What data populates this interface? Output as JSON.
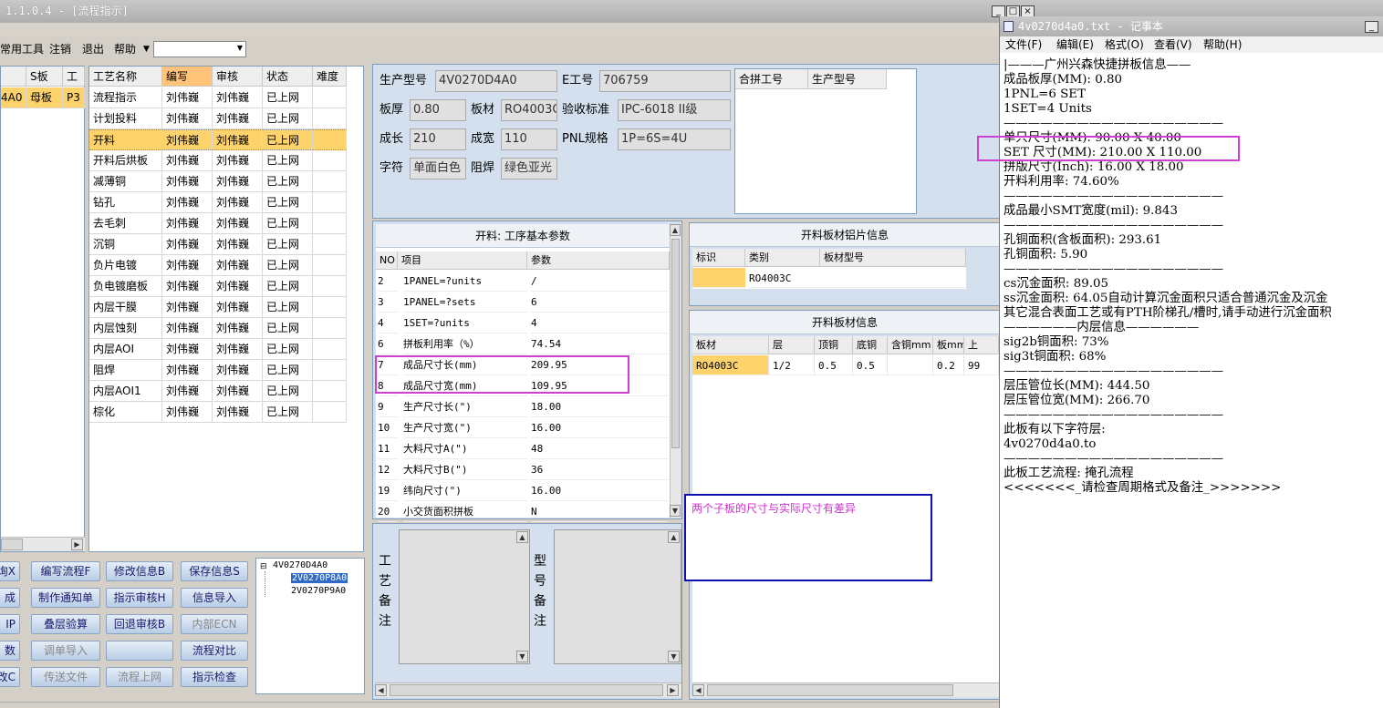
{
  "main_window": {
    "title": "1.1.0.4 - [流程指示]",
    "menu": [
      "常用工具",
      "注销",
      "退出",
      "帮助"
    ],
    "left_grid": {
      "headers": [
        "",
        "S板",
        "工"
      ],
      "row": [
        "4A0",
        "母板",
        "P3"
      ]
    },
    "process_table": {
      "headers": [
        "工艺名称",
        "编写",
        "审核",
        "状态",
        "难度"
      ],
      "rows": [
        [
          "流程指示",
          "刘伟巍",
          "刘伟巍",
          "已上网"
        ],
        [
          "计划投料",
          "刘伟巍",
          "刘伟巍",
          "已上网"
        ],
        [
          "开料",
          "刘伟巍",
          "刘伟巍",
          "已上网"
        ],
        [
          "开料后烘板",
          "刘伟巍",
          "刘伟巍",
          "已上网"
        ],
        [
          "减薄铜",
          "刘伟巍",
          "刘伟巍",
          "已上网"
        ],
        [
          "钻孔",
          "刘伟巍",
          "刘伟巍",
          "已上网"
        ],
        [
          "去毛刺",
          "刘伟巍",
          "刘伟巍",
          "已上网"
        ],
        [
          "沉铜",
          "刘伟巍",
          "刘伟巍",
          "已上网"
        ],
        [
          "负片电镀",
          "刘伟巍",
          "刘伟巍",
          "已上网"
        ],
        [
          "负电镀磨板",
          "刘伟巍",
          "刘伟巍",
          "已上网"
        ],
        [
          "内层干膜",
          "刘伟巍",
          "刘伟巍",
          "已上网"
        ],
        [
          "内层蚀刻",
          "刘伟巍",
          "刘伟巍",
          "已上网"
        ],
        [
          "内层AOI",
          "刘伟巍",
          "刘伟巍",
          "已上网"
        ],
        [
          "阻焊",
          "刘伟巍",
          "刘伟巍",
          "已上网"
        ],
        [
          "内层AOI1",
          "刘伟巍",
          "刘伟巍",
          "已上网"
        ],
        [
          "棕化",
          "刘伟巍",
          "刘伟巍",
          "已上网"
        ]
      ],
      "selected_row": 2
    },
    "info": {
      "model_label": "生产型号",
      "model": "4V0270D4A0",
      "eno_label": "E工号",
      "eno": "706759",
      "thick_label": "板厚",
      "thick": "0.80",
      "material_label": "板材",
      "material": "RO4003C",
      "standard_label": "验收标准",
      "standard": "IPC-6018 II级",
      "length_label": "成长",
      "length": "210",
      "width_label": "成宽",
      "width": "110",
      "pnl_label": "PNL规格",
      "pnl": "1P=6S=4U",
      "char_label": "字符",
      "char": "单面白色",
      "mask_label": "阻焊",
      "mask": "绿色亚光",
      "combo_headers": [
        "合拼工号",
        "生产型号"
      ]
    },
    "params": {
      "title": "开料: 工序基本参数",
      "headers": [
        "NO",
        "项目",
        "参数"
      ],
      "rows": [
        [
          "2",
          "1PANEL=?units",
          "/"
        ],
        [
          "3",
          "1PANEL=?sets",
          "6"
        ],
        [
          "4",
          "1SET=?units",
          "4"
        ],
        [
          "6",
          "拼板利用率（%）",
          "74.54"
        ],
        [
          "7",
          "成品尺寸长(mm)",
          "209.95"
        ],
        [
          "8",
          "成品尺寸宽(mm)",
          "109.95"
        ],
        [
          "9",
          "生产尺寸长(\")",
          "18.00"
        ],
        [
          "10",
          "生产尺寸宽(\")",
          "16.00"
        ],
        [
          "11",
          "大料尺寸A(\")",
          "48"
        ],
        [
          "12",
          "大料尺寸B(\")",
          "36"
        ],
        [
          "19",
          "纬向尺寸(\")",
          "16.00"
        ],
        [
          "20",
          "小交货面积拼板",
          "N"
        ]
      ]
    },
    "foil": {
      "title": "开料板材铝片信息",
      "headers": [
        "标识",
        "类别",
        "板材型号"
      ],
      "row": [
        "",
        "RO4003C",
        ""
      ]
    },
    "board": {
      "title": "开料板材信息",
      "headers": [
        "板材",
        "层",
        "顶铜",
        "底铜",
        "含铜mm",
        "板mm",
        "上"
      ],
      "row": [
        "RO4003C",
        "1/2",
        "0.5",
        "0.5",
        "",
        "0.2",
        "99"
      ]
    },
    "remark_labels": {
      "craft": [
        "工",
        "艺",
        "备",
        "注"
      ],
      "model": [
        "型",
        "号",
        "备",
        "注"
      ]
    },
    "note_text": "两个子板的尺寸与实际尺寸有差异",
    "buttons": {
      "col0": [
        "询X",
        "成",
        "IP",
        "数",
        "改C"
      ],
      "col1": [
        "编写流程F",
        "制作通知单",
        "叠层验算",
        "调单导入",
        "传送文件"
      ],
      "col2": [
        "修改信息B",
        "指示审核H",
        "回退审核B",
        "",
        "流程上网"
      ],
      "col3": [
        "保存信息S",
        "信息导入",
        "内部ECN",
        "流程对比",
        "指示检查"
      ]
    },
    "tree": {
      "root": "4V0270D4A0",
      "children": [
        "2V0270P8A0",
        "2V0270P9A0"
      ]
    }
  },
  "notepad": {
    "title": "4v0270d4a0.txt - 记事本",
    "menu": [
      "文件(F)",
      "编辑(E)",
      "格式(O)",
      "查看(V)",
      "帮助(H)"
    ],
    "lines": [
      "|———广州兴森快捷拼板信息——",
      "成品板厚(MM): 0.80",
      "1PNL=6 SET",
      "1SET=4 Units",
      "——————————————————",
      "单只尺寸(MM): 90.00 X 40.00",
      "SET 尺寸(MM): 210.00 X 110.00",
      "拼版尺寸(Inch): 16.00 X 18.00",
      "开料利用率: 74.60%",
      "——————————————————",
      "成品最小SMT宽度(mil): 9.843",
      "——————————————————",
      "孔铜面积(含板面积): 293.61",
      "孔铜面积: 5.90",
      "——————————————————",
      "cs沉金面积: 89.05",
      "ss沉金面积: 64.05自动计算沉金面积只适合普通沉金及沉金",
      "其它混合表面工艺或有PTH阶梯孔/槽时,请手动进行沉金面积",
      "——————内层信息——————",
      "sig2b铜面积: 73%",
      "sig3t铜面积: 68%",
      "——————————————————",
      "层压管位长(MM): 444.50",
      "层压管位宽(MM): 266.70",
      "——————————————————",
      "此板有以下字符层:",
      "4v0270d4a0.to",
      "——————————————————",
      "此板工艺流程: 掩孔流程",
      "<<<<<<<_请检查周期格式及备注_>>>>>>>"
    ]
  },
  "colors": {
    "highlight": "#ffd36b",
    "annotation": "#d040d0",
    "note_border": "#1010b0"
  }
}
